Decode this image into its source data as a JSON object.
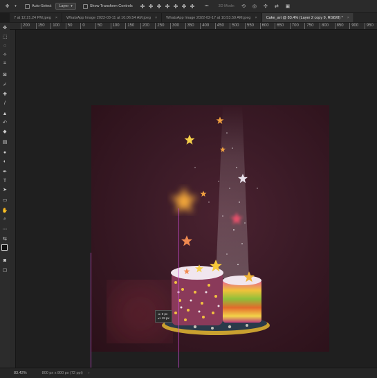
{
  "options_bar": {
    "auto_select_label": "Auto-Select",
    "layer_select_value": "Layer",
    "show_transform_label": "Show Transform Controls",
    "more_label": "•••",
    "mode_3d_label": "3D Mode:"
  },
  "tabs": [
    {
      "label": "7 at 12.21.24 PM.jpeg",
      "active": false
    },
    {
      "label": "WhatsApp Image 2022-03-11 at 10.06.54 AM.jpeg",
      "active": false
    },
    {
      "label": "WhatsApp Image 2022-02-17 at 10.53.59 AM.jpeg",
      "active": false
    },
    {
      "label": "Cake_art @ 83.4% (Layer 2 copy 9, RGB/8) *",
      "active": true
    }
  ],
  "ruler": {
    "ticks": [
      "200",
      "150",
      "100",
      "50",
      "0",
      "50",
      "100",
      "150",
      "200",
      "250",
      "300",
      "350",
      "400",
      "450",
      "500",
      "550",
      "600",
      "650",
      "700",
      "750",
      "800",
      "850",
      "900",
      "950",
      "1000"
    ]
  },
  "measure": {
    "dx": "0 px",
    "dy": "19 px"
  },
  "status": {
    "zoom": "83.42%",
    "doc_size": "800 px x 800 px (72 ppi)",
    "arrow": "›"
  },
  "colors": {
    "guide": "#c94bd0",
    "canvas_bg": "#3a1a26",
    "ui_bg": "#1d1d1d"
  },
  "tools": [
    "move-icon",
    "marquee-icon",
    "lasso-icon",
    "magic-wand-icon",
    "crop-icon",
    "frame-icon",
    "eyedropper-icon",
    "healing-icon",
    "brush-icon",
    "clone-stamp-icon",
    "history-brush-icon",
    "eraser-icon",
    "gradient-icon",
    "blur-icon",
    "dodge-icon",
    "pen-icon",
    "type-icon",
    "path-select-icon",
    "shape-icon",
    "hand-icon",
    "zoom-icon",
    "more-tools-icon"
  ]
}
